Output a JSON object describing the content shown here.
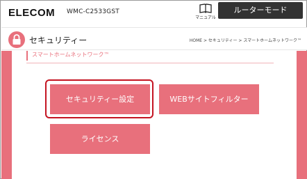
{
  "header": {
    "logo": "ELECOM",
    "model": "WMC-C2533GST",
    "manual_label": "マニュアル",
    "mode_label": "ルーターモード"
  },
  "page": {
    "title": "セキュリティー",
    "breadcrumb": "HOME > セキュリティー > スマートホームネットワーク™"
  },
  "section": {
    "heading": "スマートホームネットワーク™"
  },
  "tiles": [
    {
      "label": "セキュリティー設定"
    },
    {
      "label": "WEBサイトフィルター"
    },
    {
      "label": "ライセンス"
    }
  ],
  "colors": {
    "accent": "#e8707c",
    "highlight": "#c41422",
    "mode_button": "#333333"
  },
  "icons": {
    "manual": "book-icon",
    "title": "lock-icon"
  }
}
